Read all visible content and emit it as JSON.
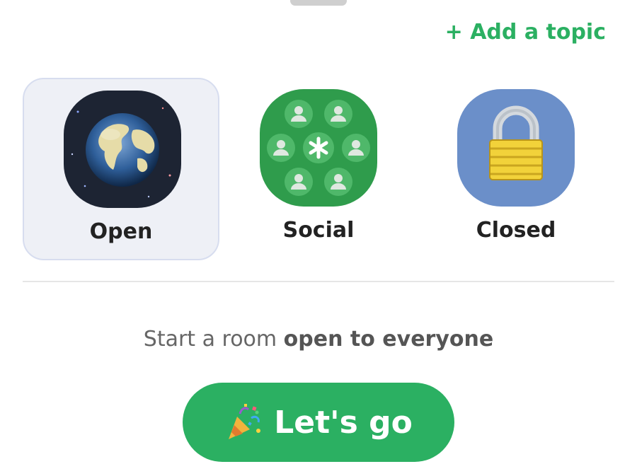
{
  "sheet": {
    "add_topic_label": "+ Add a topic"
  },
  "room_types": [
    {
      "id": "open",
      "label": "Open",
      "selected": true,
      "icon": "globe-icon"
    },
    {
      "id": "social",
      "label": "Social",
      "selected": false,
      "icon": "social-group-icon"
    },
    {
      "id": "closed",
      "label": "Closed",
      "selected": false,
      "icon": "padlock-icon"
    }
  ],
  "description": {
    "prefix": "Start a room ",
    "emphasis": "open to everyone"
  },
  "go_button": {
    "label": "Let's go",
    "icon": "party-popper-icon"
  },
  "colors": {
    "accent": "#2bb062",
    "selected_bg": "#eef0f6",
    "selected_border": "#d7ddef"
  }
}
